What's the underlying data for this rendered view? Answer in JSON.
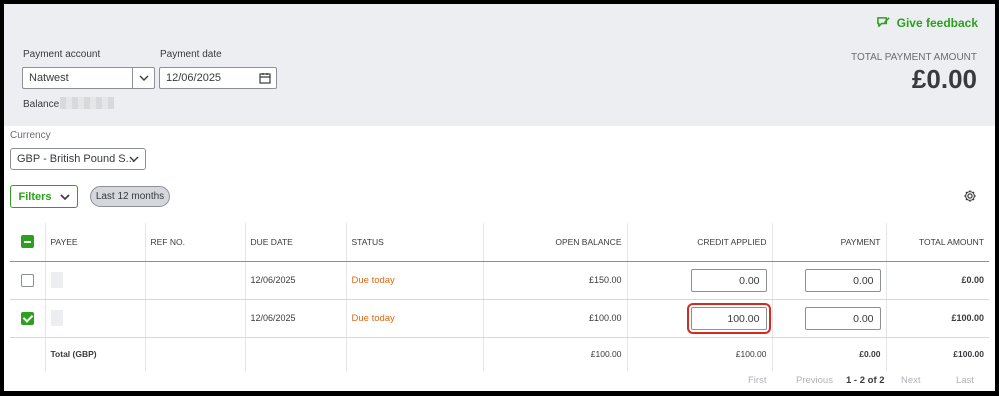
{
  "header": {
    "feedback_label": "Give feedback",
    "payment_account_label": "Payment account",
    "payment_account_value": "Natwest",
    "payment_date_label": "Payment date",
    "payment_date_value": "12/06/2025",
    "balance_label": "Balance:",
    "total_payment_label": "TOTAL PAYMENT AMOUNT",
    "total_payment_value": "£0.00"
  },
  "currency": {
    "label": "Currency",
    "value": "GBP - British Pound S..."
  },
  "filters": {
    "button_label": "Filters",
    "pill_label": "Last 12 months"
  },
  "table": {
    "columns": [
      "PAYEE",
      "REF NO.",
      "DUE DATE",
      "STATUS",
      "OPEN BALANCE",
      "CREDIT APPLIED",
      "PAYMENT",
      "TOTAL AMOUNT"
    ],
    "rows": [
      {
        "checked": false,
        "payee": "",
        "ref_no": "",
        "due_date": "12/06/2025",
        "status": "Due today",
        "open_balance": "£150.00",
        "credit_applied": "0.00",
        "payment": "0.00",
        "total_amount": "£0.00"
      },
      {
        "checked": true,
        "payee": "",
        "ref_no": "",
        "due_date": "12/06/2025",
        "status": "Due today",
        "open_balance": "£100.00",
        "credit_applied": "100.00",
        "payment": "0.00",
        "total_amount": "£100.00"
      }
    ],
    "total_row": {
      "label": "Total (GBP)",
      "open_balance": "£100.00",
      "credit_applied": "£100.00",
      "payment": "£0.00",
      "total_amount": "£100.00"
    }
  },
  "pagination": {
    "first": "First",
    "previous": "Previous",
    "range": "1 - 2 of 2",
    "next": "Next",
    "last": "Last"
  },
  "colors": {
    "accent": "#2ca01c",
    "status_due": "#dc6a12",
    "highlight": "#d52b1e",
    "header_band": "#eceef1"
  }
}
